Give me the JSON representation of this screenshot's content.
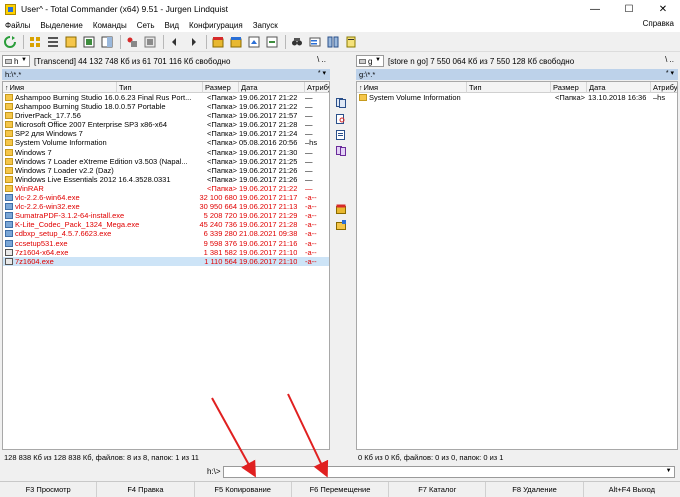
{
  "window": {
    "title": "User^ - Total Commander (x64) 9.51 - Jurgen Lindquist",
    "minimize": "—",
    "maximize": "☐",
    "close": "✕"
  },
  "menu": {
    "items": [
      "Файлы",
      "Выделение",
      "Команды",
      "Сеть",
      "Вид",
      "Конфигурация",
      "Запуск"
    ],
    "help": "Справка"
  },
  "left": {
    "drive": "h",
    "drive_info": "[Transcend]  44 132 748 Кб из 61 701 116 Кб свободно",
    "drive_tools": "\\    ..",
    "path": "h:\\*.*",
    "path_ctrl": "*  ▾",
    "headers": [
      "Имя",
      "Тип",
      "Размер",
      "Дата",
      "Атрибу"
    ],
    "rows": [
      {
        "name": "Ashampoo Burning Studio 16.0.6.23 Final Rus Port...",
        "size": "<Папка>",
        "date": "19.06.2017 21:22",
        "attr": "—",
        "icon": "folder",
        "red": false,
        "selected": false
      },
      {
        "name": "Ashampoo Burning Studio 18.0.0.57 Portable",
        "size": "<Папка>",
        "date": "19.06.2017 21:22",
        "attr": "—",
        "icon": "folder",
        "red": false,
        "selected": false
      },
      {
        "name": "DriverPack_17.7.56",
        "size": "<Папка>",
        "date": "19.06.2017 21:57",
        "attr": "—",
        "icon": "folder",
        "red": false,
        "selected": false
      },
      {
        "name": "Microsoft Office 2007 Enterprise SP3 x86-x64",
        "size": "<Папка>",
        "date": "19.06.2017 21:28",
        "attr": "—",
        "icon": "folder",
        "red": false,
        "selected": false
      },
      {
        "name": "SP2 для Windows 7",
        "size": "<Папка>",
        "date": "19.06.2017 21:24",
        "attr": "—",
        "icon": "folder",
        "red": false,
        "selected": false
      },
      {
        "name": "System Volume Information",
        "size": "<Папка>",
        "date": "05.08.2016 20:56",
        "attr": "–hs",
        "icon": "folder",
        "red": false,
        "selected": false
      },
      {
        "name": "Windows 7",
        "size": "<Папка>",
        "date": "19.06.2017 21:30",
        "attr": "—",
        "icon": "folder",
        "red": false,
        "selected": false
      },
      {
        "name": "Windows 7 Loader eXtreme Edition v3.503 (Napal...",
        "size": "<Папка>",
        "date": "19.06.2017 21:25",
        "attr": "—",
        "icon": "folder",
        "red": false,
        "selected": false
      },
      {
        "name": "Windows 7 Loader v2.2 (Daz)",
        "size": "<Папка>",
        "date": "19.06.2017 21:26",
        "attr": "—",
        "icon": "folder",
        "red": false,
        "selected": false
      },
      {
        "name": "Windows Live Essentials 2012 16.4.3528.0331",
        "size": "<Папка>",
        "date": "19.06.2017 21:26",
        "attr": "—",
        "icon": "folder",
        "red": false,
        "selected": false
      },
      {
        "name": "WinRAR",
        "size": "<Папка>",
        "date": "19.06.2017 21:22",
        "attr": "—",
        "icon": "folder",
        "red": true,
        "selected": false
      },
      {
        "name": "vlc-2.2.6-win64.exe",
        "size": "32 100 680",
        "date": "19.06.2017 21:17",
        "attr": "-a--",
        "icon": "exe",
        "red": true,
        "selected": false
      },
      {
        "name": "vlc-2.2.6-win32.exe",
        "size": "30 950 664",
        "date": "19.06.2017 21:13",
        "attr": "-a--",
        "icon": "exe",
        "red": true,
        "selected": false
      },
      {
        "name": "SumatraPDF-3.1.2-64-install.exe",
        "size": "5 208 720",
        "date": "19.06.2017 21:29",
        "attr": "-a--",
        "icon": "exe",
        "red": true,
        "selected": false
      },
      {
        "name": "K-Lite_Codec_Pack_1324_Mega.exe",
        "size": "45 240 736",
        "date": "19.06.2017 21:28",
        "attr": "-a--",
        "icon": "exe",
        "red": true,
        "selected": false
      },
      {
        "name": "cdbxp_setup_4.5.7.6623.exe",
        "size": "6 339 280",
        "date": "21.08.2021 09:38",
        "attr": "-a--",
        "icon": "exe",
        "red": true,
        "selected": false
      },
      {
        "name": "ccsetup531.exe",
        "size": "9 598 376",
        "date": "19.06.2017 21:16",
        "attr": "-a--",
        "icon": "exe",
        "red": true,
        "selected": false
      },
      {
        "name": "7z1604-x64.exe",
        "size": "1 381 582",
        "date": "19.06.2017 21:10",
        "attr": "-a--",
        "icon": "archive",
        "red": true,
        "selected": false
      },
      {
        "name": "7z1604.exe",
        "size": "1 110 564",
        "date": "19.06.2017 21:10",
        "attr": "-a--",
        "icon": "archive",
        "red": true,
        "selected": true
      }
    ],
    "status": "128 838 Кб из 128 838 Кб, файлов: 8 из 8, папок: 1 из 11"
  },
  "right": {
    "drive": "g",
    "drive_info": "[store n go]  7 550 064 Кб из 7 550 128 Кб свободно",
    "drive_tools": "\\    ..",
    "path": "g:\\*.*",
    "path_ctrl": "*  ▾",
    "headers": [
      "Имя",
      "Тип",
      "Размер",
      "Дата",
      "Атрибу"
    ],
    "rows": [
      {
        "name": "System Volume Information",
        "size": "<Папка>",
        "date": "13.10.2018 16:36",
        "attr": "–hs",
        "icon": "folder",
        "red": false,
        "selected": false
      }
    ],
    "status": "0 Кб из 0 Кб, файлов: 0 из 0, папок: 0 из 1"
  },
  "cmdline": {
    "prompt": "h:\\>"
  },
  "fkeys": [
    "F3 Просмотр",
    "F4 Правка",
    "F5 Копирование",
    "F6 Перемещение",
    "F7 Каталог",
    "F8 Удаление",
    "Alt+F4 Выход"
  ],
  "colors": {
    "accent_path": "#bdd2ea",
    "selected_row": "#cde4f7",
    "red_text": "#e00000",
    "annotation_arrow": "#e02020"
  }
}
